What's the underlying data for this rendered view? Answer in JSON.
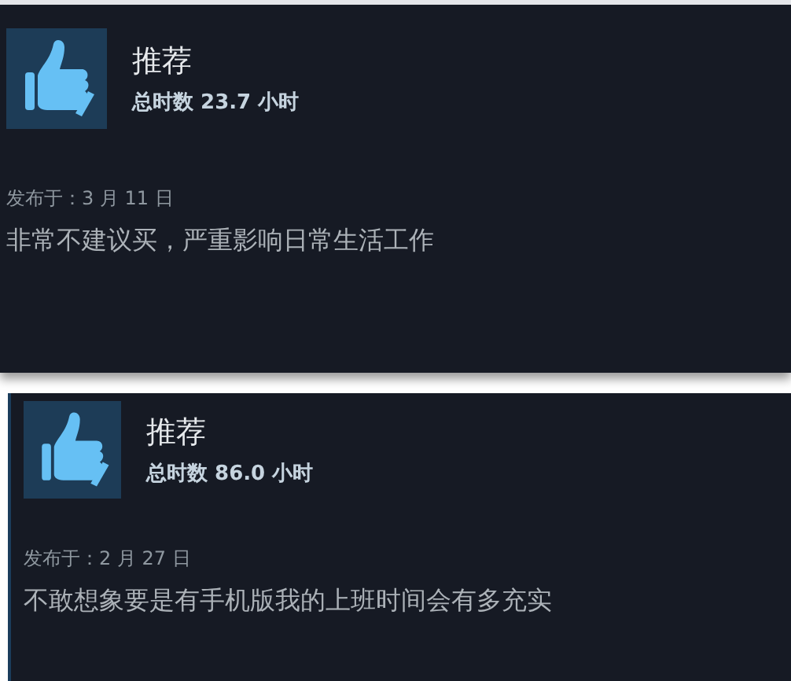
{
  "reviews": [
    {
      "recommended": true,
      "verdict": "推荐",
      "hours": "总时数 23.7 小时",
      "posted": "发布于：3 月 11 日",
      "text": "非常不建议买，严重影响日常生活工作"
    },
    {
      "recommended": true,
      "verdict": "推荐",
      "hours": "总时数 86.0 小时",
      "posted": "发布于：2 月 27 日",
      "text": "不敢想象要是有手机版我的上班时间会有多充实"
    }
  ]
}
